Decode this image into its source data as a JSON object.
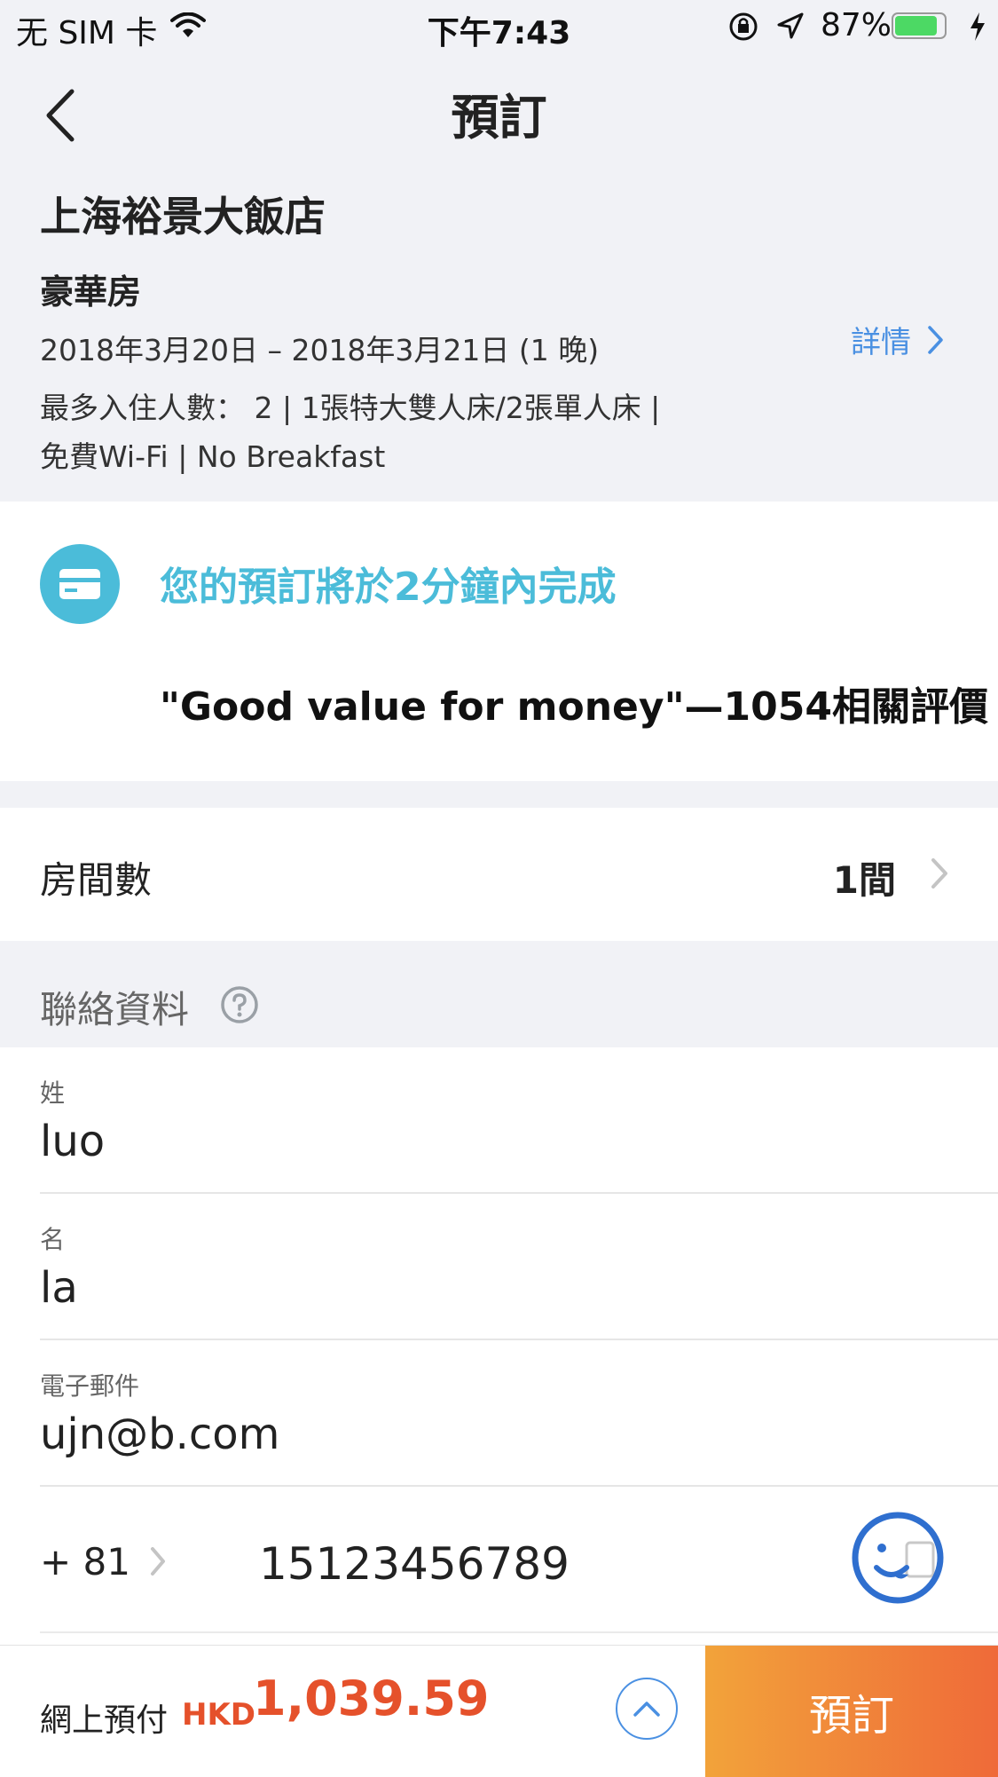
{
  "status_bar": {
    "carrier": "无 SIM 卡",
    "time": "下午7:43",
    "battery": "87%",
    "battery_level": 0.87,
    "battery_color": "#4cd964"
  },
  "nav": {
    "title": "預訂"
  },
  "hotel": {
    "name": "上海裕景大飯店",
    "room_type": "豪華房",
    "dates": "2018年3月20日 – 2018年3月21日 (1 晚)",
    "details_line1": "最多入住人數： 2 | 1張特大雙人床/2張單人床 |",
    "details_line2": "免費Wi-Fi | No Breakfast",
    "details_link": "詳情"
  },
  "promo": {
    "title": "您的預訂將於2分鐘內完成",
    "review": "\"Good value for money\"—1054相關評價",
    "accent_color": "#4bbcd9"
  },
  "rooms": {
    "label": "房間數",
    "value": "1間"
  },
  "contact": {
    "title": "聯絡資料",
    "fields": [
      {
        "label": "姓",
        "value": "luo"
      },
      {
        "label": "名",
        "value": "la"
      },
      {
        "label": "電子郵件",
        "value": "ujn@b.com"
      }
    ],
    "phone": {
      "country_code": "+ 81",
      "number": "15123456789"
    }
  },
  "footer": {
    "pay_label": "網上預付",
    "currency": "HKD",
    "amount": "1,039.59",
    "book_label": "預訂",
    "price_color": "#e5512b"
  }
}
